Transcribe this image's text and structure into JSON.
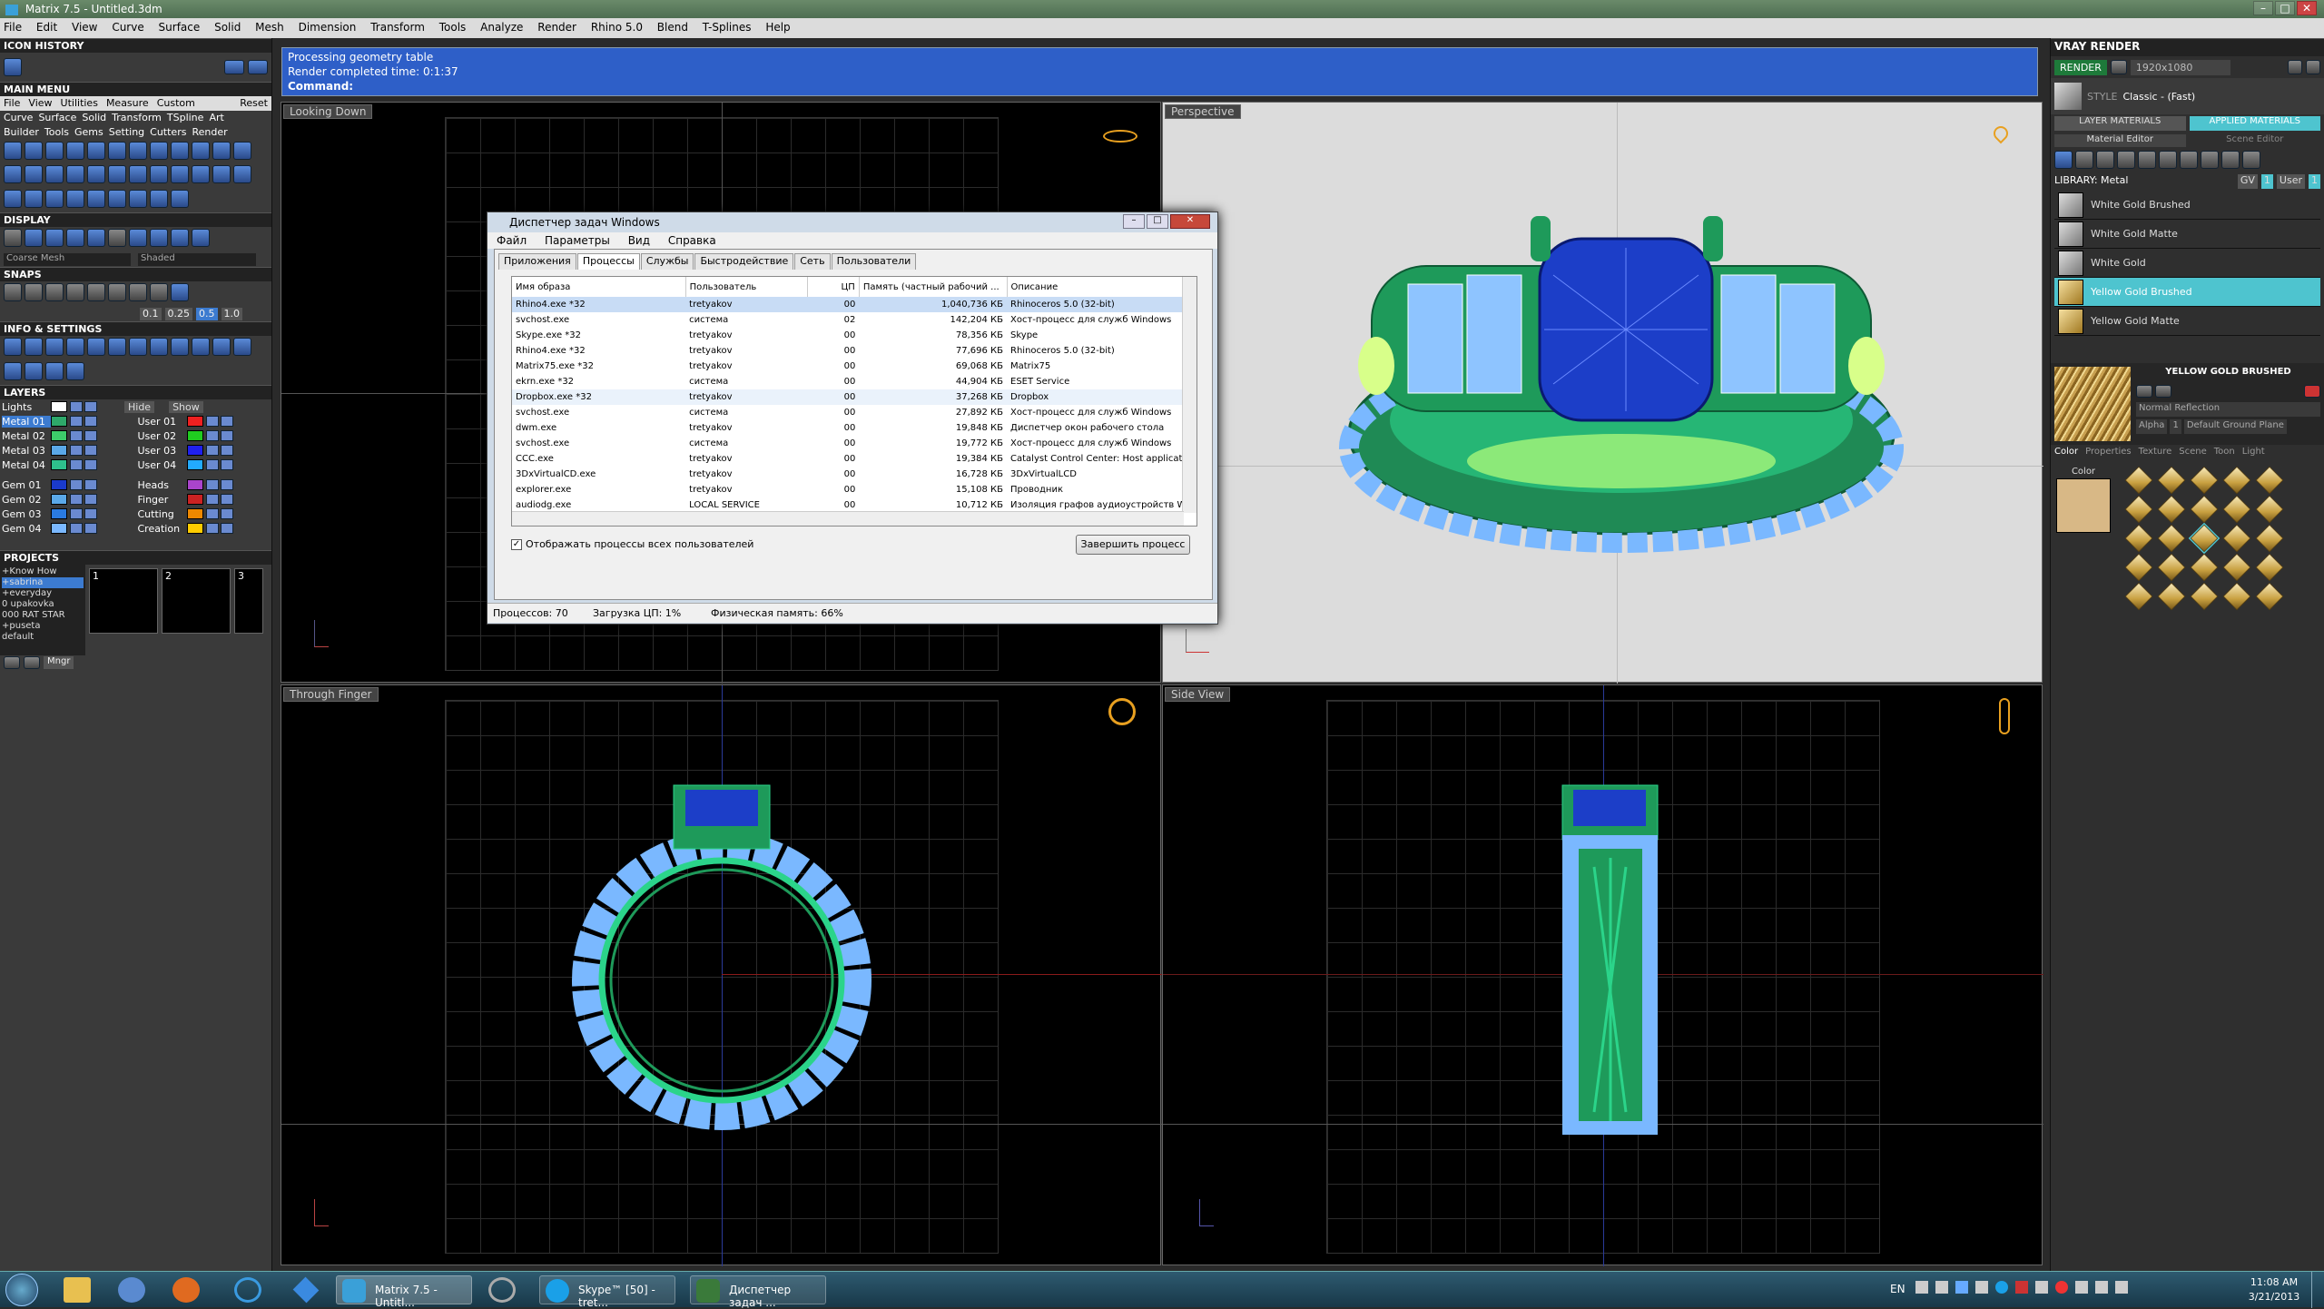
{
  "window": {
    "title": "Matrix 7.5 - Untitled.3dm"
  },
  "menubar": {
    "items": [
      "File",
      "Edit",
      "View",
      "Curve",
      "Surface",
      "Solid",
      "Mesh",
      "Dimension",
      "Transform",
      "Tools",
      "Analyze",
      "Render",
      "Rhino 5.0",
      "Blend",
      "T-Splines",
      "Help"
    ]
  },
  "left": {
    "icon_history": "ICON HISTORY",
    "main_menu": "MAIN MENU",
    "main_menu_links": [
      "File",
      "View",
      "Utilities",
      "Measure",
      "Custom",
      "Reset"
    ],
    "row1": [
      "Curve",
      "Surface",
      "Solid",
      "Transform",
      "TSpline",
      "Art"
    ],
    "row2": [
      "Builder",
      "Tools",
      "Gems",
      "Setting",
      "Cutters",
      "Render"
    ],
    "display": "DISPLAY",
    "display_modes": [
      "Coarse Mesh",
      "Shaded"
    ],
    "snaps": "SNAPS",
    "snap_values": [
      "0.1",
      "0.25",
      "0.5",
      "1.0"
    ],
    "info": "INFO & SETTINGS",
    "layers": "LAYERS",
    "layer_top": [
      "Lights",
      "Hide",
      "Show"
    ],
    "layers_left": [
      {
        "name": "Metal 01",
        "color": "#2ea86a"
      },
      {
        "name": "Metal 02",
        "color": "#3dcc6a"
      },
      {
        "name": "Metal 03",
        "color": "#5aa8e8"
      },
      {
        "name": "Metal 04",
        "color": "#2ec08c"
      },
      {
        "name": "Gem 01",
        "color": "#1a3acc"
      },
      {
        "name": "Gem 02",
        "color": "#5aa8e8"
      },
      {
        "name": "Gem 03",
        "color": "#2a7ae0"
      },
      {
        "name": "Gem 04",
        "color": "#7ab8ff"
      }
    ],
    "layers_right": [
      {
        "name": "User 01",
        "color": "#ee2020"
      },
      {
        "name": "User 02",
        "color": "#20cc20"
      },
      {
        "name": "User 03",
        "color": "#2020ee"
      },
      {
        "name": "User 04",
        "color": "#22aaff"
      },
      {
        "name": "Heads",
        "color": "#aa44cc"
      },
      {
        "name": "Finger",
        "color": "#cc2222"
      },
      {
        "name": "Cutting",
        "color": "#ee8800"
      },
      {
        "name": "Creation",
        "color": "#ffcc00"
      }
    ],
    "projects": "PROJECTS",
    "project_list": [
      "+Know How",
      "+sabrina",
      "+everyday",
      "0 upakovka",
      "000 RAT STAR",
      "+puseta",
      "default"
    ],
    "project_thumbs": [
      "1",
      "2",
      "3"
    ],
    "mngr": "Mngr"
  },
  "command": {
    "line1": "Processing geometry table",
    "line2": "Render completed time: 0:1:37",
    "prompt": "Command:"
  },
  "viewports": {
    "top": "Looking Down",
    "persp": "Perspective",
    "front": "Through Finger",
    "side": "Side View"
  },
  "taskmgr": {
    "title": "Диспетчер задач Windows",
    "menu": [
      "Файл",
      "Параметры",
      "Вид",
      "Справка"
    ],
    "tabs": [
      "Приложения",
      "Процессы",
      "Службы",
      "Быстродействие",
      "Сеть",
      "Пользователи"
    ],
    "columns": [
      "Имя образа",
      "Пользователь",
      "ЦП",
      "Память (частный рабочий ...",
      "Описание"
    ],
    "rows": [
      [
        "Rhino4.exe *32",
        "tretyakov",
        "00",
        "1,040,736 КБ",
        "Rhinoceros 5.0 (32-bit)"
      ],
      [
        "svchost.exe",
        "система",
        "02",
        "142,204 КБ",
        "Хост-процесс для служб Windows"
      ],
      [
        "Skype.exe *32",
        "tretyakov",
        "00",
        "78,356 КБ",
        "Skype"
      ],
      [
        "Rhino4.exe *32",
        "tretyakov",
        "00",
        "77,696 КБ",
        "Rhinoceros 5.0 (32-bit)"
      ],
      [
        "Matrix75.exe *32",
        "tretyakov",
        "00",
        "69,068 КБ",
        "Matrix75"
      ],
      [
        "ekrn.exe *32",
        "система",
        "00",
        "44,904 КБ",
        "ESET Service"
      ],
      [
        "Dropbox.exe *32",
        "tretyakov",
        "00",
        "37,268 КБ",
        "Dropbox"
      ],
      [
        "svchost.exe",
        "система",
        "00",
        "27,892 КБ",
        "Хост-процесс для служб Windows"
      ],
      [
        "dwm.exe",
        "tretyakov",
        "00",
        "19,848 КБ",
        "Диспетчер окон рабочего стола"
      ],
      [
        "svchost.exe",
        "система",
        "00",
        "19,772 КБ",
        "Хост-процесс для служб Windows"
      ],
      [
        "CCC.exe",
        "tretyakov",
        "00",
        "19,384 КБ",
        "Catalyst Control Center: Host applicati"
      ],
      [
        "3DxVirtualCD.exe",
        "tretyakov",
        "00",
        "16,728 КБ",
        "3DxVirtualLCD"
      ],
      [
        "explorer.exe",
        "tretyakov",
        "00",
        "15,108 КБ",
        "Проводник"
      ],
      [
        "audiodg.exe",
        "LOCAL SERVICE",
        "00",
        "10,712 КБ",
        "Изоляция графов аудиоустройств Wi"
      ]
    ],
    "show_all": "Отображать процессы всех пользователей",
    "end_process": "Завершить процесс",
    "status": [
      "Процессов: 70",
      "Загрузка ЦП: 1%",
      "Физическая память: 66%"
    ]
  },
  "right": {
    "vray": "VRAY RENDER",
    "render": "RENDER",
    "resolution": "1920x1080",
    "style_label": "STYLE",
    "style_value": "Classic - (Fast)",
    "tabs": [
      "LAYER MATERIALS",
      "APPLIED MATERIALS"
    ],
    "subtabs": [
      "Material Editor",
      "Scene Editor"
    ],
    "library": "LIBRARY: Metal",
    "library_tags": [
      "GV",
      "1",
      "User",
      "1"
    ],
    "materials": [
      "White Gold Brushed",
      "White Gold Matte",
      "White Gold",
      "Yellow Gold Brushed",
      "Yellow Gold Matte"
    ],
    "selected_name": "YELLOW GOLD BRUSHED",
    "reflection": "Normal Reflection",
    "alpha": "Alpha",
    "alpha_value": "1",
    "ground": "Default Ground Plane",
    "bottom_tabs": [
      "Color",
      "Properties",
      "Texture",
      "Scene",
      "Toon",
      "Light"
    ],
    "color_label": "Color",
    "swatch": "#d8b886"
  },
  "taskbar": {
    "items": [
      "Matrix 7.5 - Untitl...",
      "Skype™ [50] - tret...",
      "Диспетчер задач ..."
    ],
    "lang": "EN",
    "time": "11:08 AM",
    "date": "3/21/2013"
  }
}
